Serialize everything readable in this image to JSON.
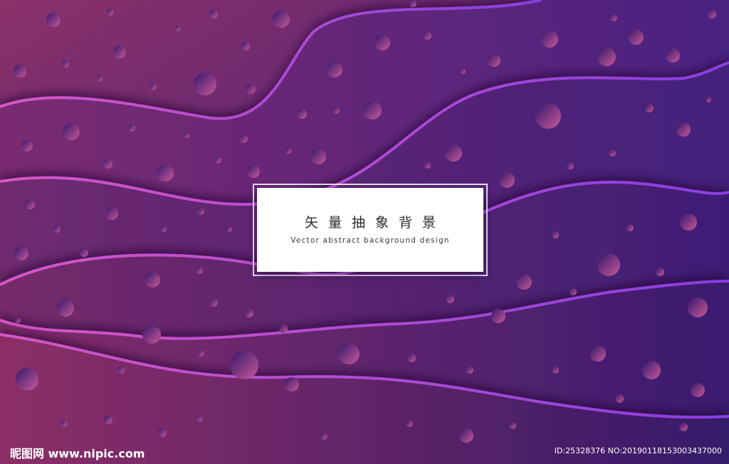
{
  "card": {
    "title": "矢量抽象背景",
    "subtitle": "Vector abstract background design"
  },
  "watermark": {
    "site": "昵图网 www.nipic.com",
    "id": "ID:25328376 NO:20190118153003437000"
  },
  "colors": {
    "bg_left": "#7a2c6c",
    "bg_right": "#3c1a78",
    "edge_glow": "#c44fd8",
    "bubble_light": "#c85a9a",
    "bubble_dark": "#33166a"
  }
}
